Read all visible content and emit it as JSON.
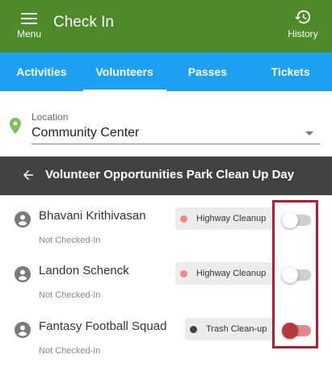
{
  "colors": {
    "appbar": "#4f8a2a",
    "tabbar": "#1ea0f2",
    "header": "#424242",
    "highlight": "#b01d36",
    "toggle_on_knob": "#b5373f",
    "toggle_on_track": "#e08a8f"
  },
  "appbar": {
    "menu_label": "Menu",
    "title": "Check In",
    "history_label": "History",
    "menu_icon": "hamburger-icon",
    "history_icon": "history-icon"
  },
  "tabs": [
    {
      "label": "Activities",
      "active": false
    },
    {
      "label": "Volunteers",
      "active": true
    },
    {
      "label": "Passes",
      "active": false
    },
    {
      "label": "Tickets",
      "active": false
    }
  ],
  "location": {
    "label": "Location",
    "value": "Community Center",
    "icon": "map-pin-icon"
  },
  "header": {
    "back_icon": "arrow-left-icon",
    "title": "Volunteer Opportunities Park Clean Up Day"
  },
  "volunteers": [
    {
      "name": "Bhavani Krithivasan",
      "status": "Not Checked-In",
      "activity": "Highway Cleanup",
      "activity_color": "#ef8a8a",
      "checked_in": false
    },
    {
      "name": "Landon Schenck",
      "status": "Not Checked-In",
      "activity": "Highway Cleanup",
      "activity_color": "#ef8a8a",
      "checked_in": false
    },
    {
      "name": "Fantasy Football Squad",
      "status": "Not Checked-In",
      "activity": "Trash Clean-up",
      "activity_color": "#404040",
      "checked_in": true
    }
  ]
}
